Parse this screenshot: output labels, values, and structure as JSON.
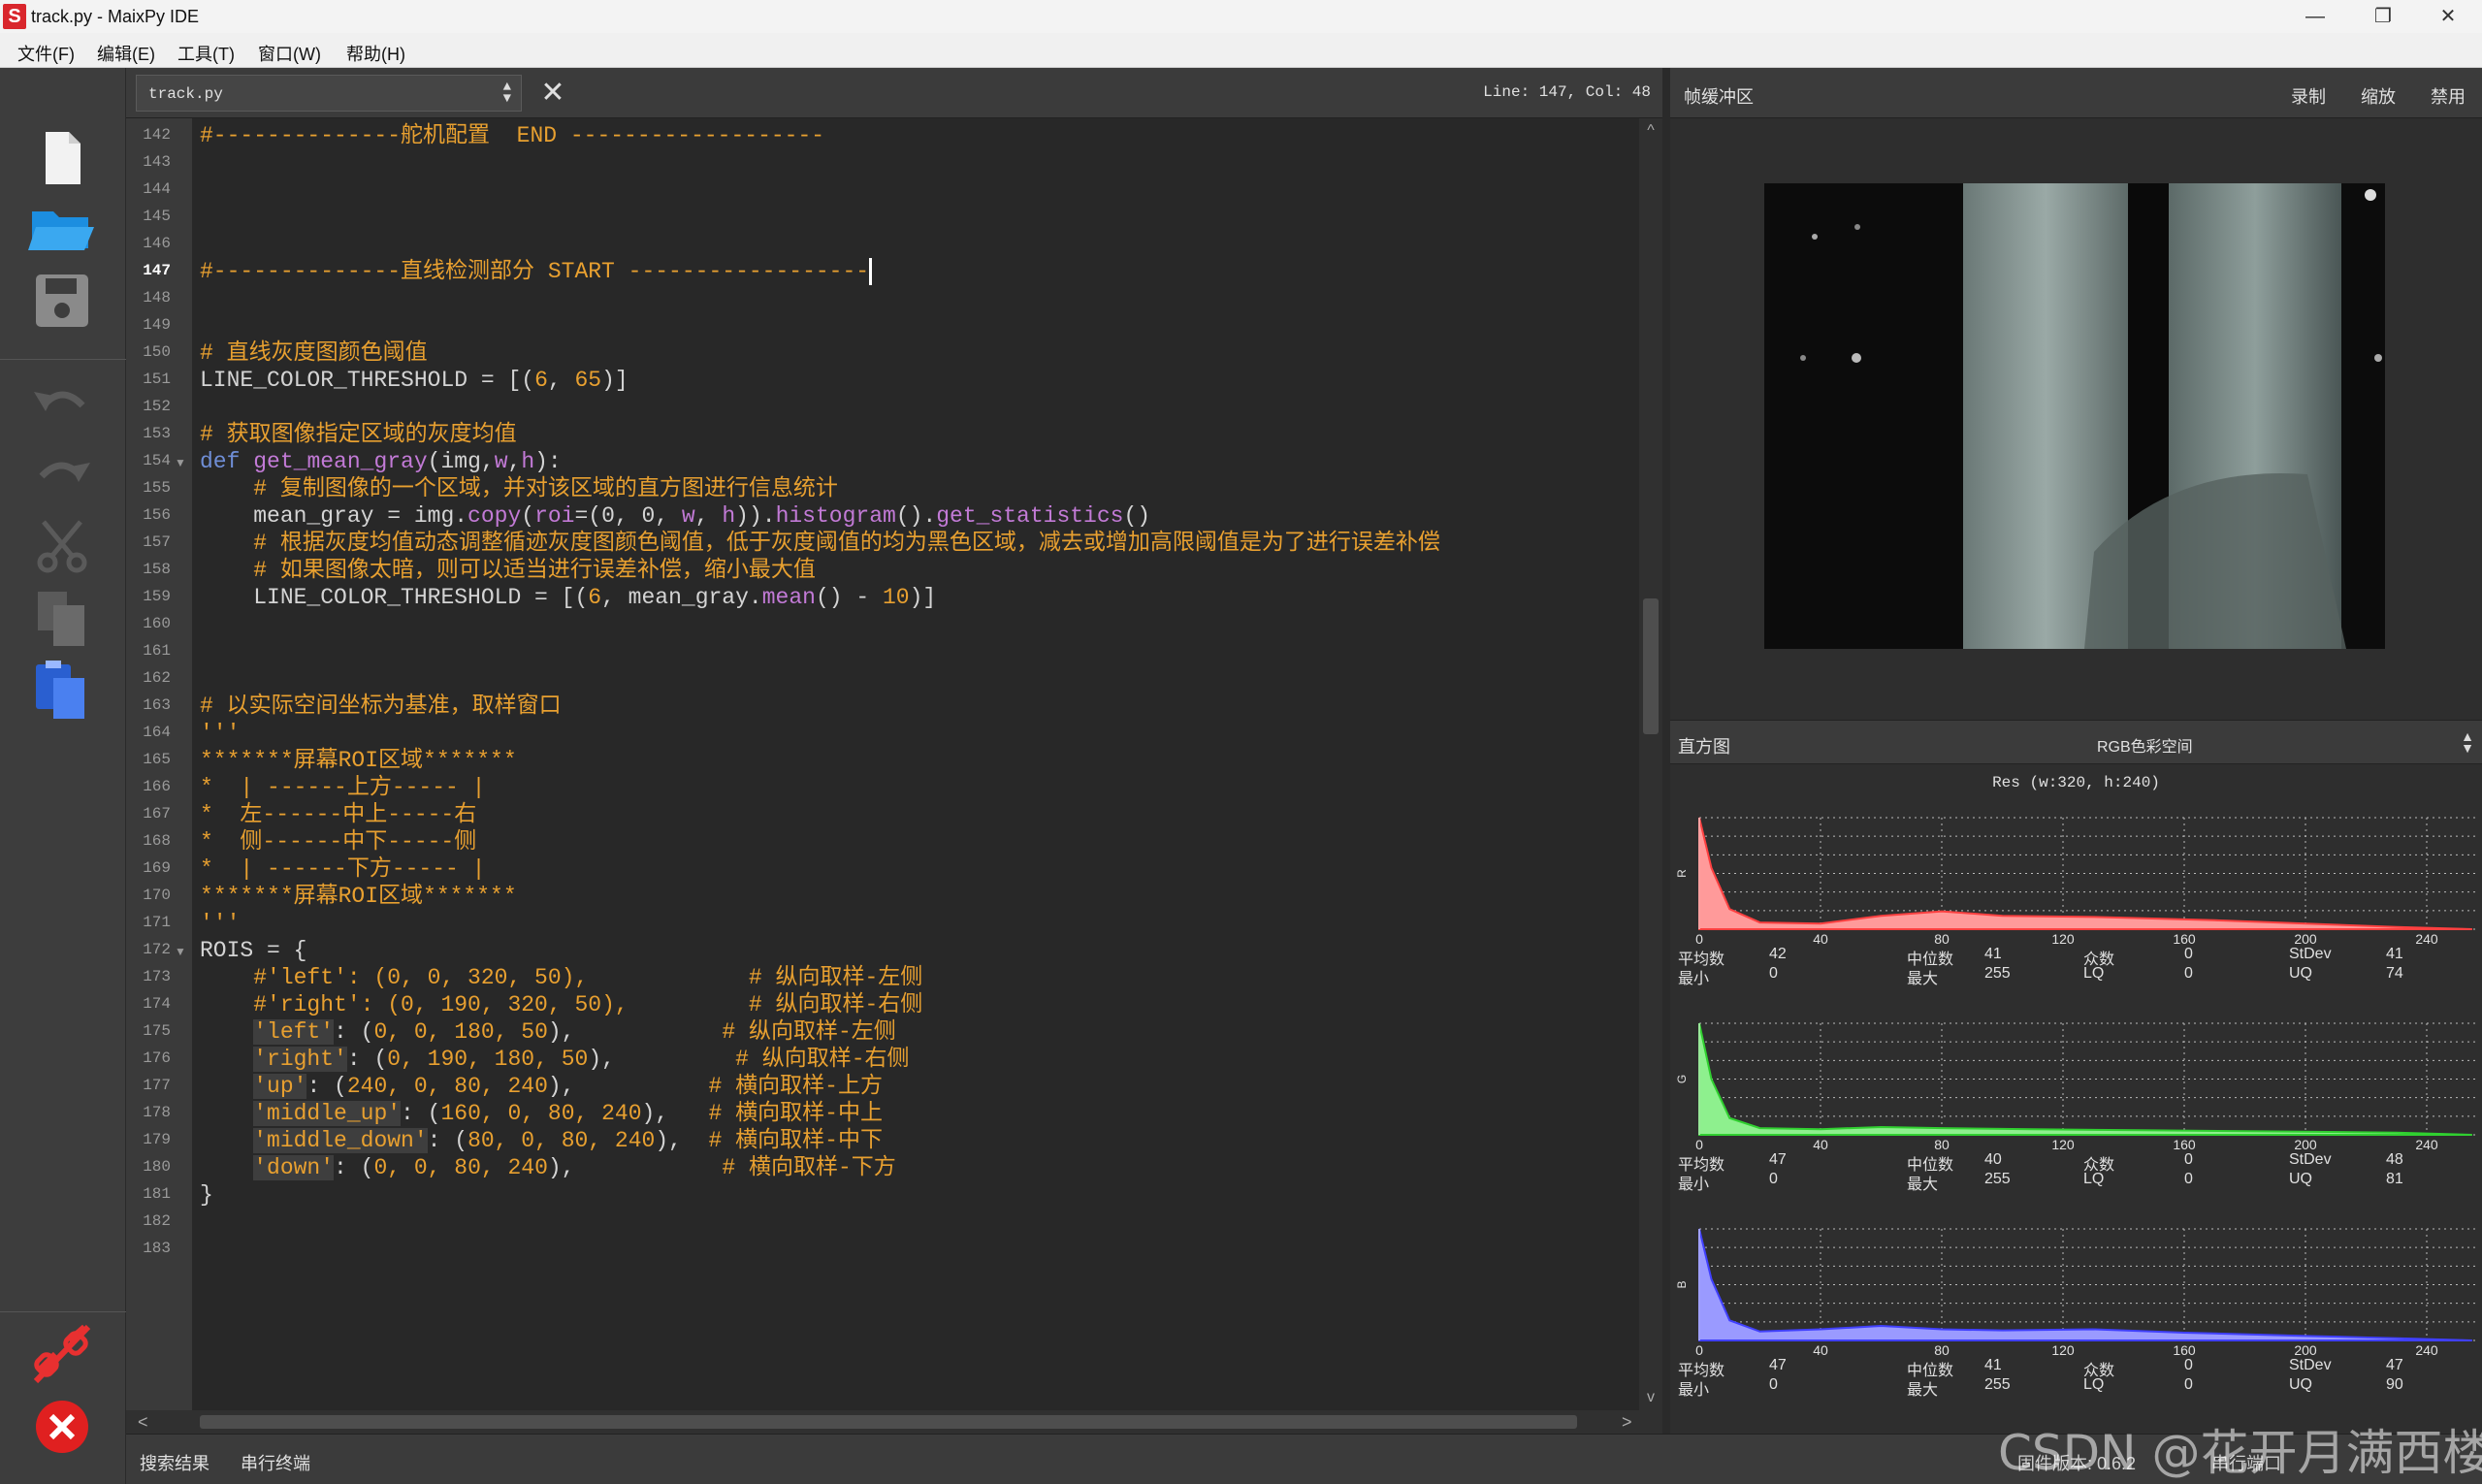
{
  "window": {
    "title": "track.py - MaixPy IDE",
    "app_icon": "S",
    "minimize": "—",
    "restore": "❐",
    "close": "✕"
  },
  "menubar": {
    "items": [
      "文件(F)",
      "编辑(E)",
      "工具(T)",
      "窗口(W)",
      "帮助(H)"
    ]
  },
  "toolbar": {
    "icons": [
      "new-file-icon",
      "open-folder-icon",
      "save-icon",
      "undo-icon",
      "redo-icon",
      "cut-icon",
      "copy-icon",
      "paste-icon",
      "disconnect-icon",
      "stop-icon"
    ]
  },
  "editor": {
    "file_name": "track.py",
    "cursor_position": "Line: 147, Col: 48",
    "active_line": "147",
    "line_numbers": [
      "142",
      "143",
      "144",
      "145",
      "146",
      "147",
      "148",
      "149",
      "150",
      "151",
      "152",
      "153",
      "154",
      "155",
      "156",
      "157",
      "158",
      "159",
      "160",
      "161",
      "162",
      "163",
      "164",
      "165",
      "166",
      "167",
      "168",
      "169",
      "170",
      "171",
      "172",
      "173",
      "174",
      "175",
      "176",
      "177",
      "178",
      "179",
      "180",
      "181",
      "182",
      "183"
    ],
    "lines": {
      "l142": "#--------------舵机配置  END -------------------",
      "l147": "#--------------直线检测部分 START ------------------",
      "l150": "# 直线灰度图颜色阈值",
      "l151a": "LINE_COLOR_THRESHOLD = [(",
      "l151b": "6",
      "l151c": ", ",
      "l151d": "65",
      "l151e": ")]",
      "l153": "# 获取图像指定区域的灰度均值",
      "l154a": "def",
      "l154b": "get_mean_gray",
      "l154c": "(img,",
      "l154d": "w",
      "l154e": ",",
      "l154f": "h",
      "l154g": "):",
      "l155": "    # 复制图像的一个区域，并对该区域的直方图进行信息统计",
      "l156a": "    mean_gray = img.",
      "l156b": "copy",
      "l156c": "(",
      "l156d": "roi",
      "l156e": "=(0, 0, ",
      "l156f": "w",
      "l156g": ", ",
      "l156h": "h",
      "l156i": ")).",
      "l156j": "histogram",
      "l156k": "().",
      "l156l": "get_statistics",
      "l156m": "()",
      "l157": "    # 根据灰度均值动态调整循迹灰度图颜色阈值，低于灰度阈值的均为黑色区域，减去或增加高限阈值是为了进行误差补偿",
      "l158": "    # 如果图像太暗，则可以适当进行误差补偿，缩小最大值",
      "l159a": "    LINE_COLOR_THRESHOLD = [(",
      "l159b": "6",
      "l159c": ", mean_gray.",
      "l159d": "mean",
      "l159e": "() - ",
      "l159f": "10",
      "l159g": ")]",
      "l163": "# 以实际空间坐标为基准，取样窗口",
      "l164": "'''",
      "l165": "*******屏幕ROI区域*******",
      "l166": "*  | ------上方----- |",
      "l167": "*  左------中上-----右",
      "l168": "*  侧------中下-----侧",
      "l169": "*  | ------下方----- |",
      "l170": "*******屏幕ROI区域*******",
      "l171": "'''",
      "l172": "ROIS = {",
      "l173": "    #'left': (0, 0, 320, 50),            # 纵向取样-左侧",
      "l174": "    #'right': (0, 190, 320, 50),         # 纵向取样-右侧",
      "l175a": "'left'",
      "l175b": ": (",
      "l175c": "0, 0, 180, 50",
      "l175d": "),           ",
      "l175e": "# 纵向取样-左侧",
      "l176a": "'right'",
      "l176b": ": (",
      "l176c": "0, 190, 180, 50",
      "l176d": "),         ",
      "l176e": "# 纵向取样-右侧",
      "l177a": "'up'",
      "l177b": ": (",
      "l177c": "240, 0, 80, 240",
      "l177d": "),          ",
      "l177e": "# 横向取样-上方",
      "l178a": "'middle_up'",
      "l178b": ": (",
      "l178c": "160, 0, 80, 240",
      "l178d": "),   ",
      "l178e": "# 横向取样-中上",
      "l179a": "'middle_down'",
      "l179b": ": (",
      "l179c": "80, 0, 80, 240",
      "l179d": "),  ",
      "l179e": "# 横向取样-中下",
      "l180a": "'down'",
      "l180b": ": (",
      "l180c": "0, 0, 80, 240",
      "l180d": "),           ",
      "l180e": "# 横向取样-下方",
      "l181": "}"
    }
  },
  "framebuffer": {
    "title": "帧缓冲区",
    "record": "录制",
    "zoom": "缩放",
    "disable": "禁用"
  },
  "histogram": {
    "title": "直方图",
    "color_space": "RGB色彩空间",
    "resolution": "Res (w:320, h:240)",
    "stat_labels": {
      "mean": "平均数",
      "median": "中位数",
      "mode": "众数",
      "stdev": "StDev",
      "min": "最小",
      "max": "最大",
      "lq": "LQ",
      "uq": "UQ"
    },
    "channels": [
      {
        "name": "R",
        "color": "#ff4040",
        "fill": "#ff9a9a",
        "mean": "42",
        "median": "41",
        "mode": "0",
        "stdev": "41",
        "min": "0",
        "max": "255",
        "lq": "0",
        "uq": "74"
      },
      {
        "name": "G",
        "color": "#30d030",
        "fill": "#8ef08e",
        "mean": "47",
        "median": "40",
        "mode": "0",
        "stdev": "48",
        "min": "0",
        "max": "255",
        "lq": "0",
        "uq": "81"
      },
      {
        "name": "B",
        "color": "#4040ff",
        "fill": "#9a9aff",
        "mean": "47",
        "median": "41",
        "mode": "0",
        "stdev": "47",
        "min": "0",
        "max": "255",
        "lq": "0",
        "uq": "90"
      }
    ],
    "x_ticks": [
      "0",
      "40",
      "80",
      "120",
      "160",
      "200",
      "240"
    ]
  },
  "bottom": {
    "tabs": [
      "搜索结果",
      "串行终端"
    ],
    "firmware": "固件版本: 0.6.2",
    "serial": "串行端口"
  },
  "watermark": "CSDN @花开月满西楼"
}
